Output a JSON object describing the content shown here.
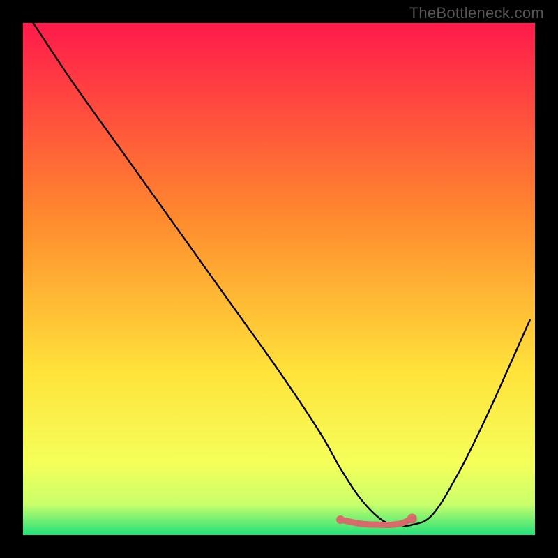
{
  "attribution": "TheBottleneck.com",
  "colors": {
    "top": "#ff1a4b",
    "mid1": "#ff8a2e",
    "mid2": "#ffe23a",
    "low1": "#f5ff5a",
    "low2": "#c9ff6a",
    "bottom": "#23e07a",
    "curve": "#000000",
    "marker": "#d76a6a"
  },
  "chart_data": {
    "type": "line",
    "title": "",
    "xlabel": "",
    "ylabel": "",
    "xlim": [
      0,
      100
    ],
    "ylim": [
      0,
      100
    ],
    "series": [
      {
        "name": "bottleneck-curve",
        "x": [
          2,
          10,
          20,
          30,
          40,
          50,
          58,
          62,
          66,
          70,
          73,
          76,
          80,
          85,
          90,
          95,
          99
        ],
        "y": [
          100,
          88,
          74,
          60,
          46,
          32,
          20,
          13,
          7,
          3,
          2,
          2,
          4,
          12,
          22,
          33,
          42
        ]
      },
      {
        "name": "optimal-band",
        "x": [
          62,
          66,
          70,
          72,
          74,
          76
        ],
        "y": [
          3.0,
          2.2,
          2.0,
          2.0,
          2.3,
          3.2
        ]
      }
    ],
    "gradient_stops": [
      {
        "pct": 0,
        "meaning": "severe-bottleneck"
      },
      {
        "pct": 50,
        "meaning": "moderate"
      },
      {
        "pct": 92,
        "meaning": "minor"
      },
      {
        "pct": 100,
        "meaning": "optimal"
      }
    ]
  }
}
